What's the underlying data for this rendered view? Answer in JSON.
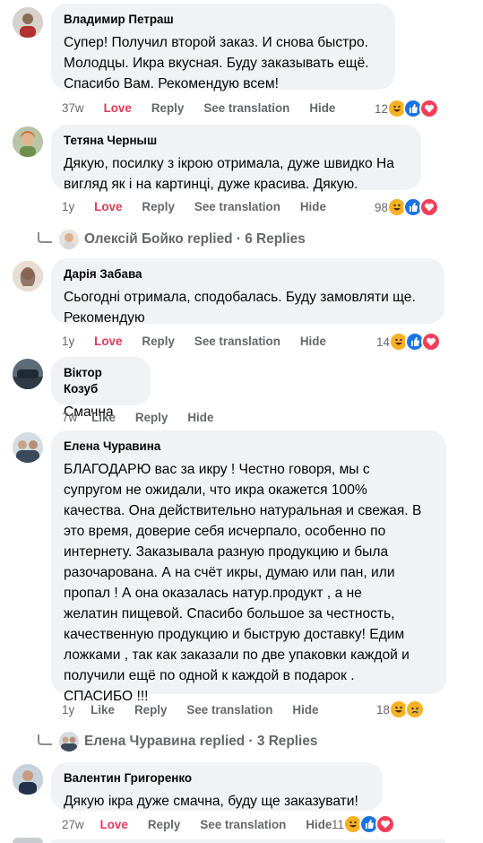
{
  "actions": {
    "love": "Love",
    "like": "Like",
    "reply": "Reply",
    "see_translation": "See translation",
    "hide": "Hide"
  },
  "comments": [
    {
      "author": "Владимир Петраш",
      "text": "Супер! Получил второй заказ. И снова быстро.\nМолодцы. Икра вкусная. Буду заказывать ещё.\nСпасибо Вам. Рекомендую всем!",
      "time": "37w",
      "react_button": "Love",
      "reaction_count": "12",
      "reaction_icons": [
        "haha-icon",
        "like-icon",
        "love-icon"
      ]
    },
    {
      "author": "Тетяна Черныш",
      "text": "Дякую, посилку з ікрою отримала, дуже швидко На\nвигляд як і на картинці, дуже красива. Дякую.",
      "time": "1y",
      "react_button": "Love",
      "reaction_count": "98",
      "reaction_icons": [
        "haha-icon",
        "like-icon",
        "love-icon"
      ]
    },
    {
      "author": "Дарія Забава",
      "text": "Сьогодні отримала, сподобалась. Буду замовляти ще.\nРекомендую",
      "time": "1y",
      "react_button": "Love",
      "reaction_count": "14",
      "reaction_icons": [
        "haha-icon",
        "like-icon",
        "love-icon"
      ]
    },
    {
      "author": "Віктор Козуб",
      "text": "Смачна",
      "time": "7w",
      "react_button": "Like",
      "reaction_count": "",
      "reaction_icons": []
    },
    {
      "author": "Елена Чуравина",
      "text": "БЛАГОДАРЮ вас за икру ! Честно говоря, мы с\nсупругом не ожидали, что икра окажется 100%\nкачества. Она действительно натуральная и свежая. В\nэто время, доверие себя исчерпало, особенно по\nинтернету. Заказывала разную продукцию и была\nразочарована. А на счёт икры, думаю или пан, или\nпропал ! А она оказалась натур.продукт , а не\nжелатин пищевой. Спасибо большое за честность,\nкачественную продукцию и быструю доставку! Едим\nложками , так как заказали по две упаковки каждой и\nполучили ещё по одной к каждой в подарок .\nСПАСИБО !!!",
      "time": "1y",
      "react_button": "Like",
      "reaction_count": "18",
      "reaction_icons": [
        "haha-icon",
        "sad-icon"
      ]
    },
    {
      "author": "Валентин Григоренко",
      "text": "Дякую ікра дуже смачна, буду ще заказувати!",
      "time": "27w",
      "react_button": "Love",
      "reaction_count": "11",
      "reaction_icons": [
        "haha-icon",
        "like-icon",
        "love-icon"
      ]
    }
  ],
  "reply_threads": [
    {
      "label": "Олексій Бойко replied · 6 Replies"
    },
    {
      "label": "Елена Чуравина replied · 3 Replies"
    }
  ],
  "colors": {
    "bubble": "#f0f2f5",
    "meta": "#65676b",
    "love_red": "#e0385c",
    "like_blue": "#1b74e4",
    "haha_yellow": "#f7b125",
    "love_heart": "#f33e58"
  }
}
